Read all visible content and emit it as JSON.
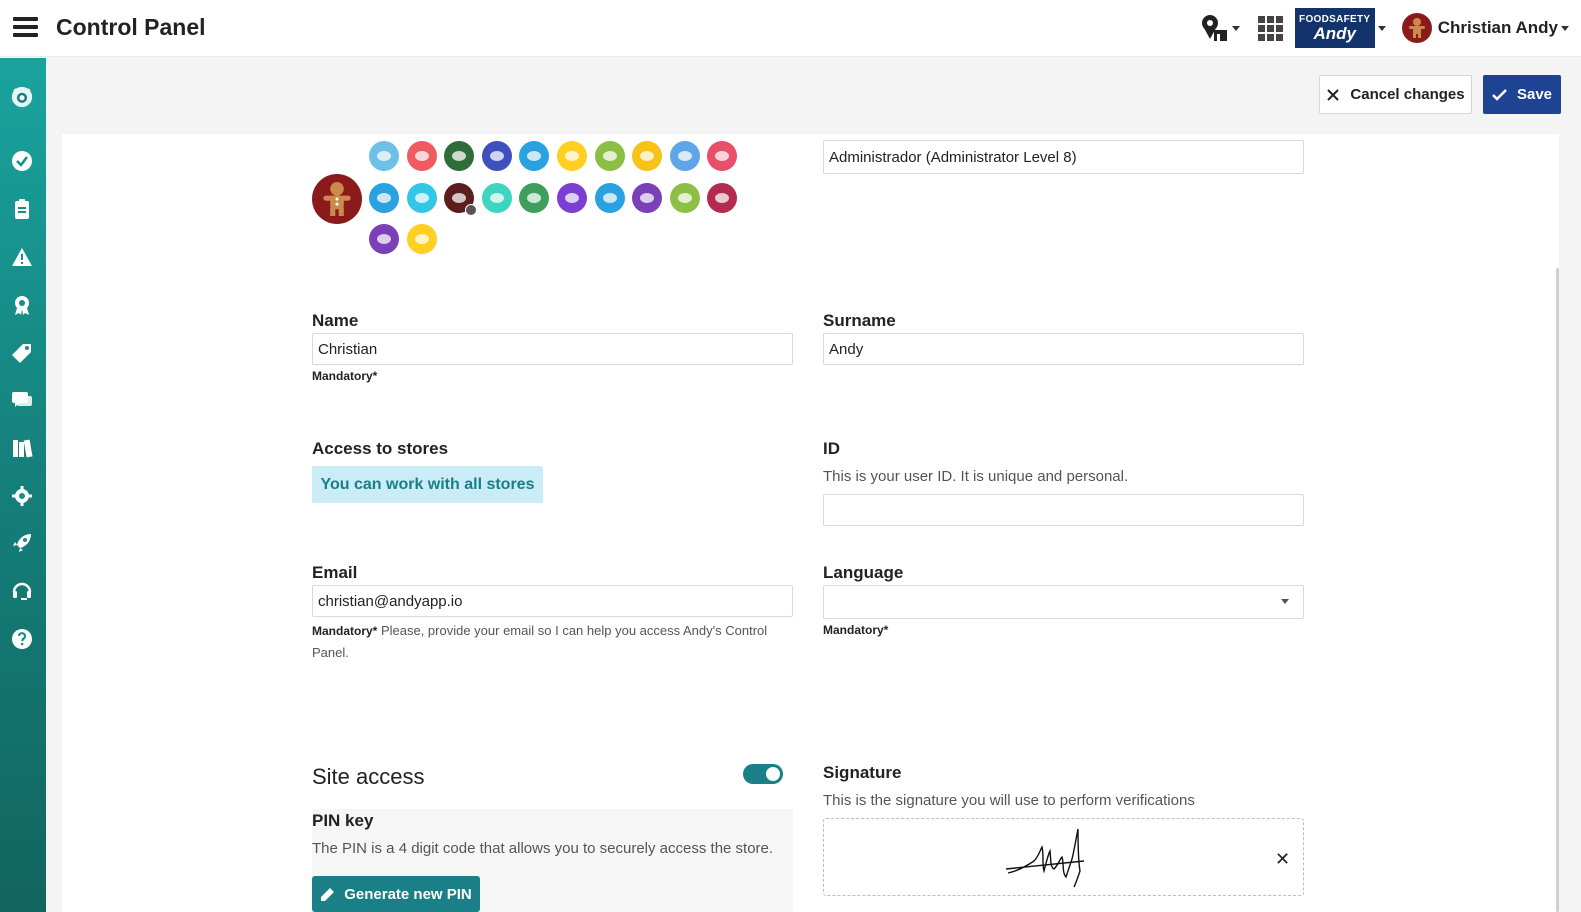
{
  "app": {
    "title": "Control Panel"
  },
  "header": {
    "brand_line1": "FOODSAFETY",
    "brand_line2": "Andy",
    "user_name": "Christian Andy"
  },
  "sidebar": {
    "items": [
      "app-logo-icon",
      "check-icon",
      "clipboard-icon",
      "warning-icon",
      "award-icon",
      "tag-icon",
      "chat-icon",
      "book-icon",
      "settings-icon",
      "rocket-icon",
      "headset-icon",
      "help-icon"
    ]
  },
  "actions": {
    "cancel_label": "Cancel changes",
    "save_label": "Save"
  },
  "colors": {
    "accent": "#1a7f86",
    "save": "#1e4392",
    "avatar": "#8b1a1a",
    "badge_bg": "#c9ecf6"
  },
  "avatars": {
    "row1": [
      "#6ec0e6",
      "#ee5b60",
      "#2f6d3a",
      "#3f4fbe",
      "#2aa1e0",
      "#ffcf21",
      "#8dbf45",
      "#f7c316",
      "#5fa6e8",
      "#e84f6b"
    ],
    "row2": [
      "#2aa1e0",
      "#32c7e6",
      "#5a1e1e",
      "#3dd4c0",
      "#3e9e5c",
      "#7b3fd1",
      "#2aa1e0",
      "#7b3fb8",
      "#8dbf45",
      "#b32c4f"
    ],
    "row3": [
      "#7b3fb8",
      "#ffcf21"
    ]
  },
  "form": {
    "role_value": "Administrador (Administrator Level 8)",
    "name_label": "Name",
    "name_value": "Christian",
    "name_hint": "Mandatory*",
    "surname_label": "Surname",
    "surname_value": "Andy",
    "stores_label": "Access to stores",
    "stores_value": "You can work with all stores",
    "id_label": "ID",
    "id_desc": "This is your user ID. It is unique and personal.",
    "id_value": "",
    "email_label": "Email",
    "email_value": "christian@andyapp.io",
    "email_hint_strong": "Mandatory*",
    "email_hint": " Please, provide your email so I can help you access Andy's Control Panel.",
    "language_label": "Language",
    "language_value": "",
    "language_hint": "Mandatory*"
  },
  "site_access": {
    "title": "Site access",
    "enabled": true,
    "pin_title": "PIN key",
    "pin_desc": "The PIN is a 4 digit code that allows you to securely access the store.",
    "pin_button": "Generate new PIN"
  },
  "signature": {
    "label": "Signature",
    "desc": "This is the signature you will use to perform verifications"
  }
}
